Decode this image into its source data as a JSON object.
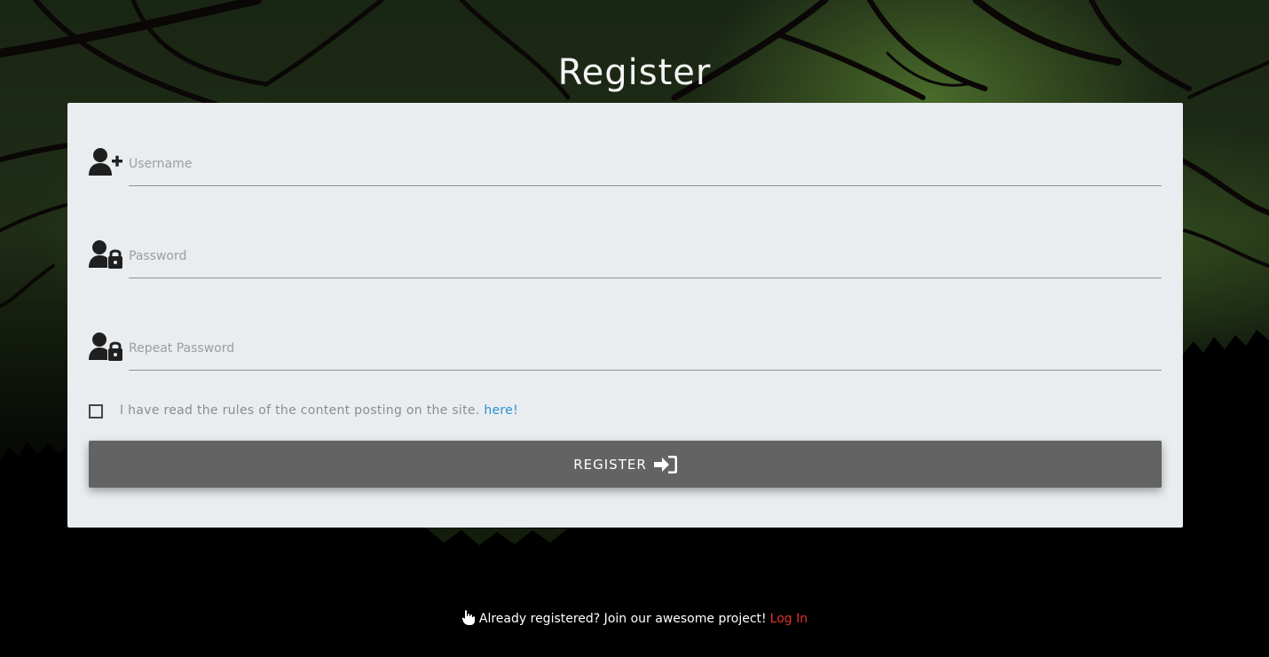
{
  "page": {
    "title": "Register",
    "accent_color": "#e0312c",
    "link_color": "#2c8fd4",
    "button_color": "#636363",
    "card_color": "#e9edf0"
  },
  "form": {
    "fields": [
      {
        "name": "username",
        "placeholder": "Username",
        "value": "",
        "icon": "user-plus-icon"
      },
      {
        "name": "password",
        "placeholder": "Password",
        "value": "",
        "icon": "user-lock-icon"
      },
      {
        "name": "repeat_password",
        "placeholder": "Repeat Password",
        "value": "",
        "icon": "user-lock-icon"
      }
    ],
    "rules_checkbox": {
      "checked": false,
      "label": "I have read the rules of the content posting on the site.",
      "link_text": "here!"
    },
    "submit": {
      "label": "REGISTER",
      "icon": "sign-in-icon"
    }
  },
  "footer": {
    "icon": "pointing-hand-icon",
    "text": "Already registered? Join our awesome project!",
    "link_text": "Log In"
  }
}
